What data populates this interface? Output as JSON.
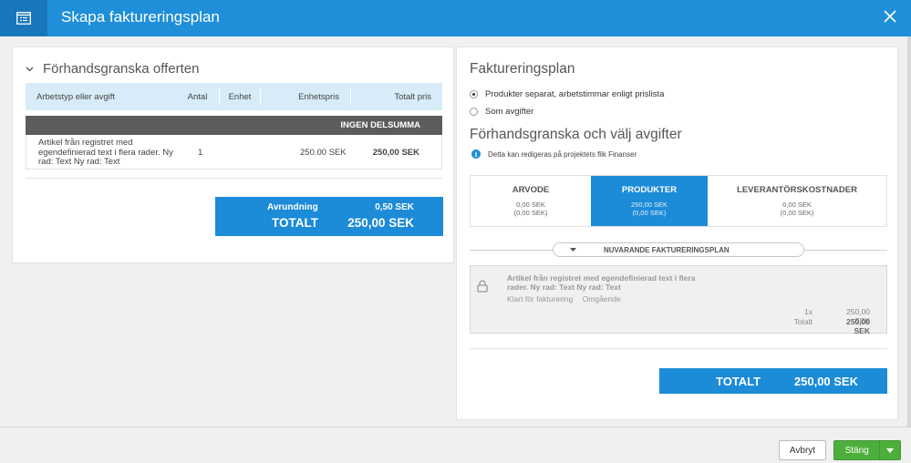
{
  "header": {
    "title": "Skapa faktureringsplan",
    "icon": "document-list-icon"
  },
  "offer_preview": {
    "title": "Förhandsgranska offerten",
    "columns": [
      "Arbetstyp eller avgift",
      "Antal",
      "Enhet",
      "Enhetspris",
      "Totalt pris"
    ],
    "group_label": "INGEN DELSUMMA",
    "rows": [
      {
        "description": "Artikel från registret med egendefinierad text i flera rader. Ny rad: Text Ny rad: Text",
        "quantity": "1",
        "unit": "",
        "unit_price": "250.00 SEK",
        "total": "250,00 SEK"
      }
    ],
    "rounding_label": "Avrundning",
    "rounding_value": "0,50 SEK",
    "total_label": "TOTALT",
    "total_value": "250,00 SEK"
  },
  "billing_plan": {
    "title": "Faktureringsplan",
    "options": [
      {
        "label": "Produkter separat, arbetstimmar enligt prislista",
        "selected": true
      },
      {
        "label": "Som avgifter",
        "selected": false
      }
    ],
    "fees_title": "Förhandsgranska och välj avgifter",
    "info_text": "Detta kan redigeras på projektets flik Finanser",
    "categories": [
      {
        "label": "ARVODE",
        "amount": "0,00 SEK",
        "sub": "(0,00 SEK)",
        "selected": false
      },
      {
        "label": "PRODUKTER",
        "amount": "250,00 SEK",
        "sub": "(0,00 SEK)",
        "selected": true
      },
      {
        "label": "LEVERANTÖRSKOSTNADER",
        "amount": "0,00 SEK",
        "sub": "(0,00 SEK)",
        "selected": false
      }
    ],
    "current_plan_label": "NUVARANDE FAKTURERINGSPLAN",
    "plan_item": {
      "description": "Artikel från registret med egendefinierad text i flera rader. Ny rad: Text Ny rad: Text",
      "status": "Klart för fakturering",
      "timing": "Omgående",
      "qty_label": "1x",
      "qty_value": "250,00 SEK",
      "total_label": "Totalt",
      "total_value": "250,00 SEK"
    },
    "total_label": "TOTALT",
    "total_value": "250,00 SEK"
  },
  "footer": {
    "cancel_label": "Avbryt",
    "close_label": "Stäng"
  },
  "colors": {
    "header_bg": "#1e8fd8",
    "accent_blue": "#1c8bd8",
    "table_header_bg": "#d7ecf8",
    "group_bar_bg": "#5c5c5c",
    "close_button_green": "#4caf3c"
  }
}
